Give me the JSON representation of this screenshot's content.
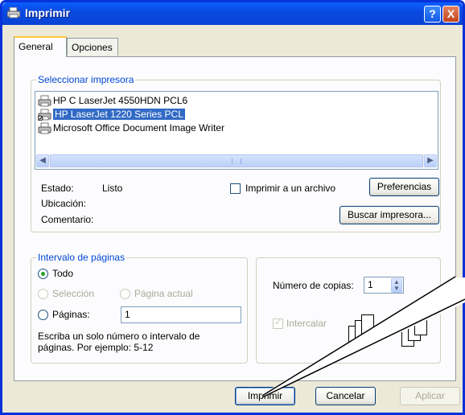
{
  "window": {
    "title": "Imprimir",
    "help": "?",
    "close": "X"
  },
  "tabs": [
    {
      "label": "General"
    },
    {
      "label": "Opciones"
    }
  ],
  "printer_group": {
    "title": "Seleccionar impresora",
    "printers": [
      {
        "name": "HP C LaserJet 4550HDN PCL6"
      },
      {
        "name": "HP LaserJet 1220 Series PCL"
      },
      {
        "name": "Microsoft Office Document Image Writer"
      }
    ],
    "selected_index": 1,
    "status_label": "Estado:",
    "status_value": "Listo",
    "location_label": "Ubicación:",
    "comment_label": "Comentario:",
    "print_to_file": "Imprimir a un archivo",
    "preferences": "Preferencias",
    "find_printer": "Buscar impresora..."
  },
  "page_range": {
    "title": "Intervalo de páginas",
    "all": "Todo",
    "selection": "Selección",
    "current_page": "Página actual",
    "pages": "Páginas:",
    "pages_value": "1",
    "hint_line1": "Escriba un solo número o intervalo de",
    "hint_line2": "páginas. Por ejemplo: 5-12"
  },
  "copies": {
    "label": "Número de copias:",
    "value": "1",
    "collate": "Intercalar",
    "collate_pages": [
      "1",
      "2",
      "3"
    ]
  },
  "footer": {
    "print": "Imprimir",
    "cancel": "Cancelar",
    "apply": "Aplicar"
  },
  "colors": {
    "titlebar": "#0a4ae0",
    "accent": "#0046d5",
    "selection": "#316ac5",
    "radio_dot": "#21a121"
  }
}
